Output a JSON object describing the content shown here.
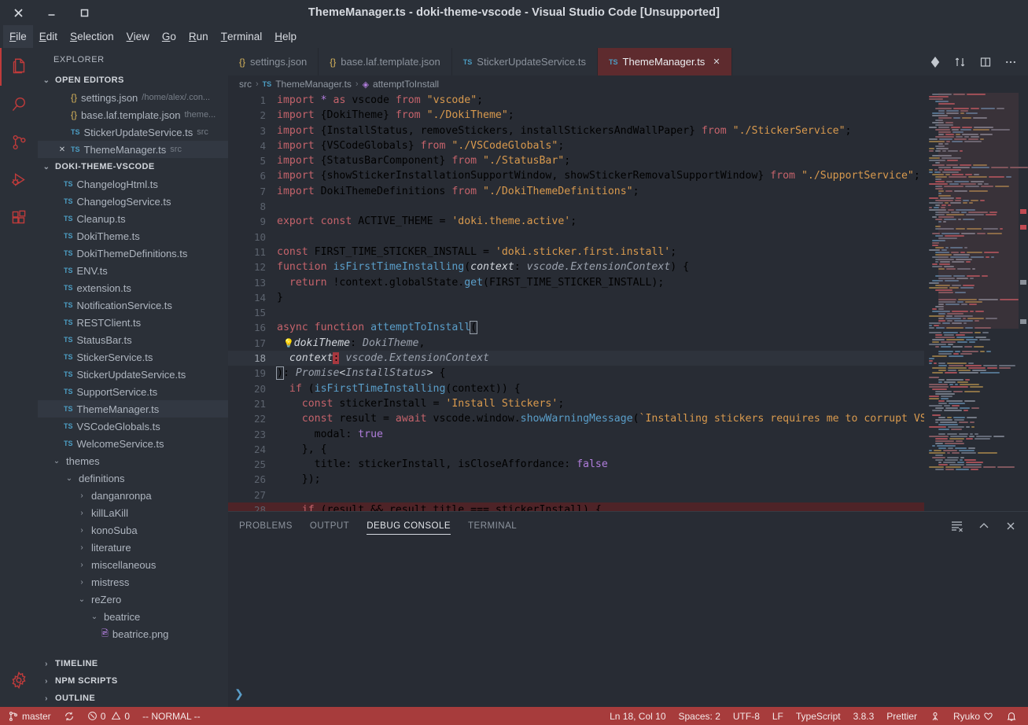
{
  "window": {
    "title": "ThemeManager.ts - doki-theme-vscode - Visual Studio Code [Unsupported]",
    "close_icon": "close-icon",
    "minimize_icon": "minimize-icon",
    "maximize_icon": "maximize-icon"
  },
  "menubar": {
    "items": [
      {
        "label": "File",
        "mnemonic": "F",
        "active": true
      },
      {
        "label": "Edit",
        "mnemonic": "E",
        "active": false
      },
      {
        "label": "Selection",
        "mnemonic": "S",
        "active": false
      },
      {
        "label": "View",
        "mnemonic": "V",
        "active": false
      },
      {
        "label": "Go",
        "mnemonic": "G",
        "active": false
      },
      {
        "label": "Run",
        "mnemonic": "R",
        "active": false
      },
      {
        "label": "Terminal",
        "mnemonic": "T",
        "active": false
      },
      {
        "label": "Help",
        "mnemonic": "H",
        "active": false
      }
    ]
  },
  "activitybar": {
    "items": [
      {
        "name": "explorer-icon",
        "selected": true
      },
      {
        "name": "search-icon",
        "selected": false
      },
      {
        "name": "source-control-icon",
        "selected": false
      },
      {
        "name": "run-and-debug-icon",
        "selected": false
      },
      {
        "name": "extensions-icon",
        "selected": false
      }
    ],
    "bottom": [
      {
        "name": "settings-gear-icon",
        "selected": false
      }
    ],
    "accent_color": "#bf3b3b"
  },
  "sidebar": {
    "title": "EXPLORER",
    "open_editors": {
      "label": "OPEN EDITORS",
      "expanded": true,
      "items": [
        {
          "icon": "json-icon",
          "name": "settings.json",
          "detail": "/home/alex/.con...",
          "selected": false,
          "dirty": false,
          "closable": false
        },
        {
          "icon": "json-icon",
          "name": "base.laf.template.json",
          "detail": "theme...",
          "selected": false,
          "dirty": false,
          "closable": false
        },
        {
          "icon": "ts-icon",
          "name": "StickerUpdateService.ts",
          "detail": "src",
          "selected": false,
          "dirty": false,
          "closable": false
        },
        {
          "icon": "ts-icon",
          "name": "ThemeManager.ts",
          "detail": "src",
          "selected": true,
          "dirty": false,
          "closable": true
        }
      ]
    },
    "project": {
      "label": "DOKI-THEME-VSCODE",
      "expanded": true,
      "files": [
        {
          "icon": "ts-icon",
          "name": "ChangelogHtml.ts",
          "indent": 1,
          "selected": false
        },
        {
          "icon": "ts-icon",
          "name": "ChangelogService.ts",
          "indent": 1,
          "selected": false
        },
        {
          "icon": "ts-icon",
          "name": "Cleanup.ts",
          "indent": 1,
          "selected": false
        },
        {
          "icon": "ts-icon",
          "name": "DokiTheme.ts",
          "indent": 1,
          "selected": false
        },
        {
          "icon": "ts-icon",
          "name": "DokiThemeDefinitions.ts",
          "indent": 1,
          "selected": false
        },
        {
          "icon": "ts-icon",
          "name": "ENV.ts",
          "indent": 1,
          "selected": false
        },
        {
          "icon": "ts-icon",
          "name": "extension.ts",
          "indent": 1,
          "selected": false
        },
        {
          "icon": "ts-icon",
          "name": "NotificationService.ts",
          "indent": 1,
          "selected": false
        },
        {
          "icon": "ts-icon",
          "name": "RESTClient.ts",
          "indent": 1,
          "selected": false
        },
        {
          "icon": "ts-icon",
          "name": "StatusBar.ts",
          "indent": 1,
          "selected": false
        },
        {
          "icon": "ts-icon",
          "name": "StickerService.ts",
          "indent": 1,
          "selected": false
        },
        {
          "icon": "ts-icon",
          "name": "StickerUpdateService.ts",
          "indent": 1,
          "selected": false
        },
        {
          "icon": "ts-icon",
          "name": "SupportService.ts",
          "indent": 1,
          "selected": false
        },
        {
          "icon": "ts-icon",
          "name": "ThemeManager.ts",
          "indent": 1,
          "selected": true
        },
        {
          "icon": "ts-icon",
          "name": "VSCodeGlobals.ts",
          "indent": 1,
          "selected": false
        },
        {
          "icon": "ts-icon",
          "name": "WelcomeService.ts",
          "indent": 1,
          "selected": false
        },
        {
          "icon": "folder-open",
          "name": "themes",
          "indent": 0,
          "selected": false
        },
        {
          "icon": "folder-open",
          "name": "definitions",
          "indent": 1,
          "selected": false
        },
        {
          "icon": "folder-closed",
          "name": "danganronpa",
          "indent": 2,
          "selected": false
        },
        {
          "icon": "folder-closed",
          "name": "killLaKill",
          "indent": 2,
          "selected": false
        },
        {
          "icon": "folder-closed",
          "name": "konoSuba",
          "indent": 2,
          "selected": false
        },
        {
          "icon": "folder-closed",
          "name": "literature",
          "indent": 2,
          "selected": false
        },
        {
          "icon": "folder-closed",
          "name": "miscellaneous",
          "indent": 2,
          "selected": false
        },
        {
          "icon": "folder-closed",
          "name": "mistress",
          "indent": 2,
          "selected": false
        },
        {
          "icon": "folder-open",
          "name": "reZero",
          "indent": 2,
          "selected": false
        },
        {
          "icon": "folder-open",
          "name": "beatrice",
          "indent": 3,
          "selected": false
        },
        {
          "icon": "image-icon",
          "name": "beatrice.png",
          "indent": 4,
          "selected": false
        }
      ]
    },
    "footers": [
      {
        "label": "TIMELINE",
        "expanded": false
      },
      {
        "label": "NPM SCRIPTS",
        "expanded": false
      },
      {
        "label": "OUTLINE",
        "expanded": false
      }
    ]
  },
  "tabs": [
    {
      "icon": "json-icon",
      "label": "settings.json",
      "active": false,
      "closable": false
    },
    {
      "icon": "json-icon",
      "label": "base.laf.template.json",
      "active": false,
      "closable": false
    },
    {
      "icon": "ts-icon",
      "label": "StickerUpdateService.ts",
      "active": false,
      "closable": false
    },
    {
      "icon": "ts-icon",
      "label": "ThemeManager.ts",
      "active": true,
      "closable": true
    }
  ],
  "tab_actions": [
    {
      "name": "run-debug-icon"
    },
    {
      "name": "split-sync-icon"
    },
    {
      "name": "split-editor-icon"
    },
    {
      "name": "more-actions-icon"
    }
  ],
  "breadcrumb": {
    "parts": [
      "src",
      "ThemeManager.ts",
      "attemptToInstall"
    ],
    "separator": "›"
  },
  "editor": {
    "active_tab_color": "#5e2b2e",
    "cursor_line": 18,
    "lines": [
      {
        "n": 1,
        "text": "import * as vscode from \"vscode\";"
      },
      {
        "n": 2,
        "text": "import {DokiTheme} from \"./DokiTheme\";"
      },
      {
        "n": 3,
        "text": "import {InstallStatus, removeStickers, installStickersAndWallPaper} from \"./StickerService\";"
      },
      {
        "n": 4,
        "text": "import {VSCodeGlobals} from \"./VSCodeGlobals\";"
      },
      {
        "n": 5,
        "text": "import {StatusBarComponent} from \"./StatusBar\";"
      },
      {
        "n": 6,
        "text": "import {showStickerInstallationSupportWindow, showStickerRemovalSupportWindow} from \"./SupportService\";"
      },
      {
        "n": 7,
        "text": "import DokiThemeDefinitions from \"./DokiThemeDefinitions\";"
      },
      {
        "n": 8,
        "text": ""
      },
      {
        "n": 9,
        "text": "export const ACTIVE_THEME = 'doki.theme.active';"
      },
      {
        "n": 10,
        "text": ""
      },
      {
        "n": 11,
        "text": "const FIRST_TIME_STICKER_INSTALL = 'doki.sticker.first.install';"
      },
      {
        "n": 12,
        "text": "function isFirstTimeInstalling(context: vscode.ExtensionContext) {"
      },
      {
        "n": 13,
        "text": "  return !context.globalState.get(FIRST_TIME_STICKER_INSTALL);"
      },
      {
        "n": 14,
        "text": "}"
      },
      {
        "n": 15,
        "text": ""
      },
      {
        "n": 16,
        "text": "async function attemptToInstall("
      },
      {
        "n": 17,
        "text": "  dokiTheme: DokiTheme,"
      },
      {
        "n": 18,
        "text": "  context: vscode.ExtensionContext"
      },
      {
        "n": 19,
        "text": "): Promise<InstallStatus> {"
      },
      {
        "n": 20,
        "text": "  if (isFirstTimeInstalling(context)) {"
      },
      {
        "n": 21,
        "text": "    const stickerInstall = 'Install Stickers';"
      },
      {
        "n": 22,
        "text": "    const result = await vscode.window.showWarningMessage(`Installing stickers requires me to corrupt VS C"
      },
      {
        "n": 23,
        "text": "      modal: true"
      },
      {
        "n": 24,
        "text": "    }, {"
      },
      {
        "n": 25,
        "text": "      title: stickerInstall, isCloseAffordance: false"
      },
      {
        "n": 26,
        "text": "    });"
      },
      {
        "n": 27,
        "text": ""
      },
      {
        "n": 28,
        "text": "    if (result && result.title === stickerInstall) {"
      }
    ]
  },
  "panel": {
    "tabs": [
      {
        "label": "PROBLEMS",
        "active": false
      },
      {
        "label": "OUTPUT",
        "active": false
      },
      {
        "label": "DEBUG CONSOLE",
        "active": true
      },
      {
        "label": "TERMINAL",
        "active": false
      }
    ],
    "actions": [
      {
        "name": "clear-console-icon"
      },
      {
        "name": "collapse-panel-icon"
      },
      {
        "name": "close-panel-icon"
      }
    ],
    "prompt": "❯"
  },
  "statusbar": {
    "background": "#a73c3c",
    "left": [
      {
        "name": "branch-item",
        "icon": "source-control-branch-icon",
        "label": "master"
      },
      {
        "name": "sync-item",
        "icon": "sync-icon",
        "label": ""
      },
      {
        "name": "problems-item",
        "icon": "error-warning-icons",
        "label": "0  0",
        "errors": "0",
        "warnings": "0"
      },
      {
        "name": "vim-mode-item",
        "icon": "",
        "label": "-- NORMAL --"
      }
    ],
    "right": [
      {
        "name": "cursor-position-item",
        "label": "Ln 18, Col 10"
      },
      {
        "name": "indentation-item",
        "label": "Spaces: 2"
      },
      {
        "name": "encoding-item",
        "label": "UTF-8"
      },
      {
        "name": "eol-item",
        "label": "LF"
      },
      {
        "name": "language-mode-item",
        "label": "TypeScript"
      },
      {
        "name": "ts-version-item",
        "label": "3.8.3"
      },
      {
        "name": "formatter-item",
        "label": "Prettier"
      },
      {
        "name": "remote-item",
        "icon": "broadcast-icon",
        "label": ""
      },
      {
        "name": "doki-theme-item",
        "label": "Ryuko",
        "icon": "heart-icon"
      },
      {
        "name": "notifications-item",
        "icon": "bell-icon",
        "label": ""
      }
    ]
  }
}
